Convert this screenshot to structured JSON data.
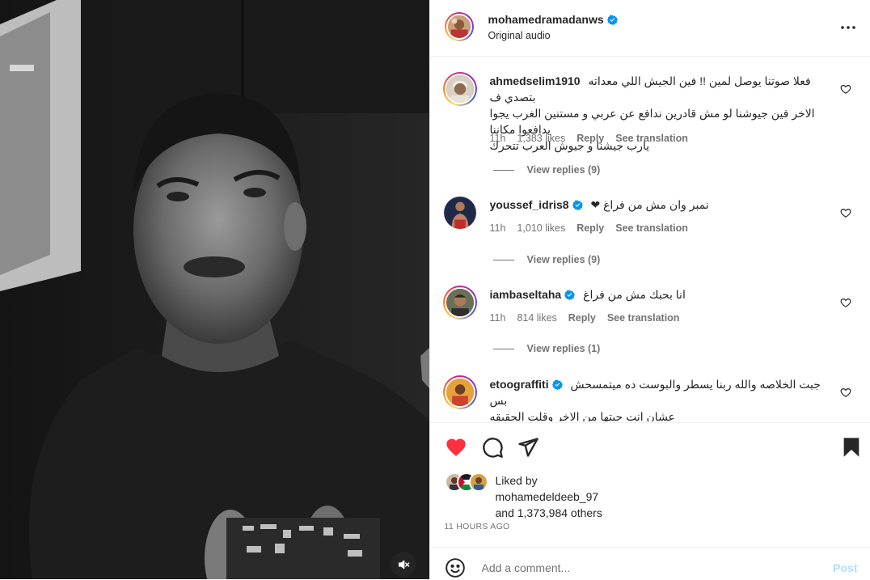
{
  "header": {
    "username": "mohamedramadanws",
    "audio": "Original audio",
    "more_icon": "more-horizontal-icon"
  },
  "comments": [
    {
      "username": "ahmedselim1910",
      "text_lines": [
        "فعلا صوتنا يوصل لمين !! فين الجيش اللي معداته بتصدي ف",
        "الاخر فين جيوشنا لو مش قادرين ندافع عن عربي و مستنين الغرب يجوا يدافعوا مكاننا",
        "يارب جيشنا و جيوش العرب تتحرك"
      ],
      "time": "11h",
      "likes": "1,383 likes",
      "reply": "Reply",
      "translate": "See translation",
      "view_replies": "View replies (9)",
      "verified": false
    },
    {
      "username": "youssef_idris8",
      "text_lines": [
        "نمبر وان مش من فراغ ❤"
      ],
      "time": "11h",
      "likes": "1,010 likes",
      "reply": "Reply",
      "translate": "See translation",
      "view_replies": "View replies (9)",
      "verified": true
    },
    {
      "username": "iambaseltaha",
      "text_lines": [
        "انا بحبك مش من فراغ"
      ],
      "time": "11h",
      "likes": "814 likes",
      "reply": "Reply",
      "translate": "See translation",
      "view_replies": "View replies (1)",
      "verified": true
    },
    {
      "username": "etoograffiti",
      "text_lines": [
        "جبت الخلاصه والله ربنا يسطر والبوست ده ميتمسحش بس",
        "عشان انت جبتها من الاخر وقلت الحقيقه"
      ],
      "verified": true
    }
  ],
  "likes": {
    "liked_by_label": "Liked by",
    "liked_by_user": "mohamedeldeeb_97",
    "others": "and 1,373,984 others"
  },
  "time_ago": "11 HOURS AGO",
  "add_comment": {
    "placeholder": "Add a comment...",
    "post_label": "Post"
  },
  "colors": {
    "like_red": "#ff3040",
    "verified_blue": "#0095f6",
    "post_disabled": "#b2dffc",
    "meta_gray": "#737373"
  }
}
